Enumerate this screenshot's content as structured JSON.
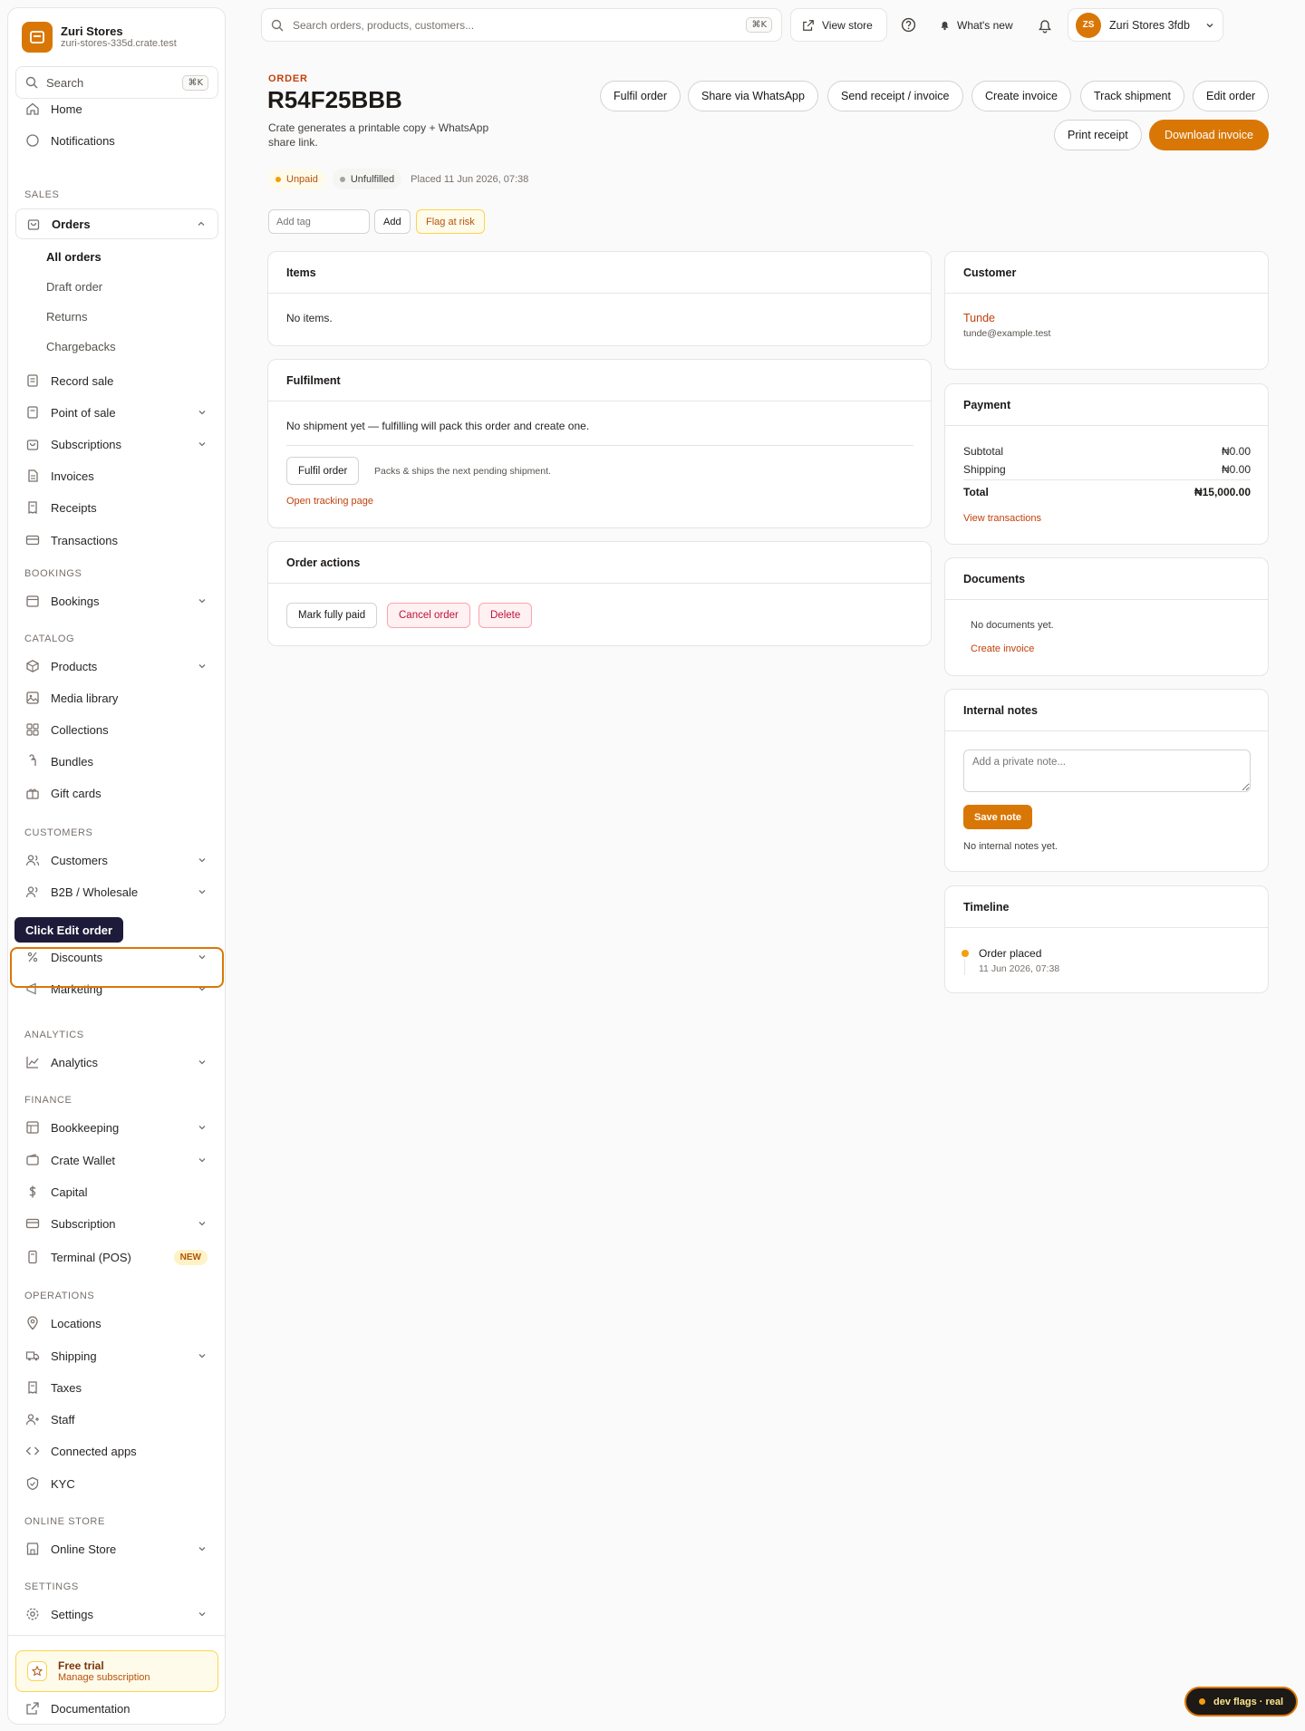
{
  "brand": {
    "name": "Zuri Stores",
    "domain": "zuri-stores-335d.crate.test"
  },
  "sidebar": {
    "search": {
      "placeholder": "Search",
      "shortcut": "⌘K"
    },
    "home": "Home",
    "notifications": "Notifications",
    "sections": {
      "sales": "SALES",
      "bookings": "BOOKINGS",
      "catalog": "CATALOG",
      "customers": "CUSTOMERS",
      "analytics": "ANALYTICS",
      "finance": "FINANCE",
      "operations": "OPERATIONS",
      "online_store": "ONLINE STORE",
      "settings": "SETTINGS"
    },
    "orders": {
      "label": "Orders",
      "sub": [
        "All orders",
        "Draft order",
        "Returns",
        "Chargebacks"
      ]
    },
    "items": {
      "record_sale": "Record sale",
      "point_of_sale": "Point of sale",
      "subscriptions": "Subscriptions",
      "invoices": "Invoices",
      "receipts": "Receipts",
      "transactions": "Transactions",
      "bookings": "Bookings",
      "products": "Products",
      "media_library": "Media library",
      "collections": "Collections",
      "bundles": "Bundles",
      "gift_cards": "Gift cards",
      "customers": "Customers",
      "b2b": "B2B / Wholesale",
      "discounts": "Discounts",
      "marketing": "Marketing",
      "analytics": "Analytics",
      "bookkeeping": "Bookkeeping",
      "crate_wallet": "Crate Wallet",
      "capital": "Capital",
      "subscription": "Subscription",
      "terminal": "Terminal (POS)",
      "terminal_badge": "NEW",
      "locations": "Locations",
      "shipping": "Shipping",
      "taxes": "Taxes",
      "staff": "Staff",
      "connected_apps": "Connected apps",
      "kyc": "KYC",
      "online_store": "Online Store",
      "settings": "Settings"
    },
    "trial": {
      "title": "Free trial",
      "subtitle": "Manage subscription"
    },
    "documentation": "Documentation"
  },
  "topbar": {
    "search_placeholder": "Search orders, products, customers...",
    "search_shortcut": "⌘K",
    "view_store": "View store",
    "whats_new": "What's new",
    "account": {
      "initials": "ZS",
      "name": "Zuri Stores 3fdb"
    }
  },
  "order": {
    "eyebrow": "ORDER",
    "id": "R54F25BBB",
    "description": "Crate generates a printable copy + WhatsApp share link.",
    "status_payment": "Unpaid",
    "status_fulfilment": "Unfulfilled",
    "placed": "Placed 11 Jun 2026, 07:38",
    "tag_placeholder": "Add tag",
    "tag_add": "Add",
    "flag": "Flag at risk"
  },
  "actions": {
    "fulfil": "Fulfil order",
    "share": "Share via WhatsApp",
    "send_receipt": "Send receipt / invoice",
    "create_invoice": "Create invoice",
    "track": "Track shipment",
    "edit": "Edit order",
    "print_receipt": "Print receipt",
    "download_invoice": "Download invoice"
  },
  "items_card": {
    "title": "Items",
    "empty": "No items."
  },
  "fulfilment_card": {
    "title": "Fulfilment",
    "message": "No shipment yet — fulfilling will pack this order and create one.",
    "button": "Fulfil order",
    "hint": "Packs & ships the next pending shipment.",
    "tracking_link": "Open tracking page"
  },
  "order_actions_card": {
    "title": "Order actions",
    "mark_paid": "Mark fully paid",
    "cancel": "Cancel order",
    "delete": "Delete"
  },
  "customer_card": {
    "title": "Customer",
    "name": "Tunde",
    "email": "tunde@example.test"
  },
  "payment_card": {
    "title": "Payment",
    "subtotal_label": "Subtotal",
    "subtotal": "₦0.00",
    "shipping_label": "Shipping",
    "shipping": "₦0.00",
    "total_label": "Total",
    "total": "₦15,000.00",
    "transactions_link": "View transactions"
  },
  "documents_card": {
    "title": "Documents",
    "empty": "No documents yet.",
    "create_link": "Create invoice"
  },
  "notes_card": {
    "title": "Internal notes",
    "placeholder": "Add a private note...",
    "save": "Save note",
    "empty": "No internal notes yet."
  },
  "timeline_card": {
    "title": "Timeline",
    "event": "Order placed",
    "time": "11 Jun 2026, 07:38"
  },
  "tooltip": "Click Edit order",
  "dev_flags": "dev flags · real",
  "colors": {
    "accent": "#d97706",
    "link": "#c2410c",
    "danger": "#be123c",
    "highlight": "#d97706"
  }
}
